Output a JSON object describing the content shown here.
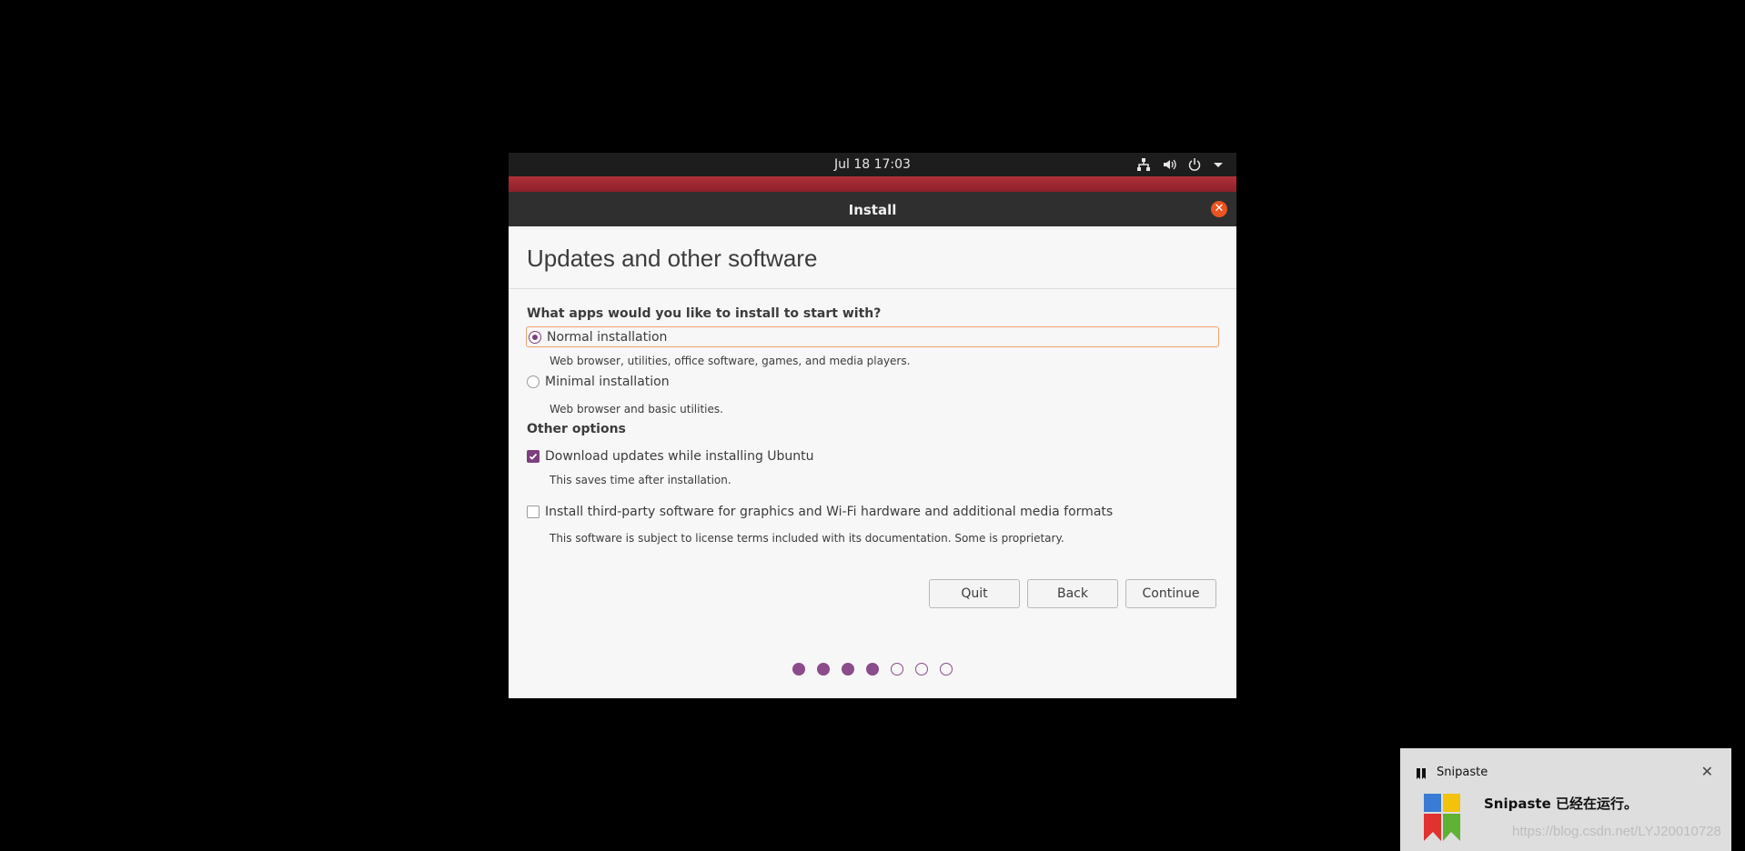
{
  "topbar": {
    "clock": "Jul 18  17:03",
    "icons": [
      "network-icon",
      "volume-icon",
      "power-icon",
      "dropdown-arrow-icon"
    ]
  },
  "window": {
    "title": "Install",
    "close_icon": "close-icon",
    "heading": "Updates and other software"
  },
  "apps": {
    "question": "What apps would you like to install to start with?",
    "normal": {
      "label": "Normal installation",
      "desc": "Web browser, utilities, office software, games, and media players.",
      "selected": true
    },
    "minimal": {
      "label": "Minimal installation",
      "desc": "Web browser and basic utilities.",
      "selected": false
    }
  },
  "other": {
    "title": "Other options",
    "updates": {
      "label": "Download updates while installing Ubuntu",
      "desc": "This saves time after installation.",
      "checked": true
    },
    "thirdparty": {
      "label": "Install third-party software for graphics and Wi-Fi hardware and additional media formats",
      "desc": "This software is subject to license terms included with its documentation. Some is proprietary.",
      "checked": false
    }
  },
  "buttons": {
    "quit": "Quit",
    "back": "Back",
    "continue": "Continue"
  },
  "progress": {
    "steps_total": 7,
    "steps_done": 4
  },
  "colors": {
    "accent": "#7e3f7e",
    "close": "#e95420",
    "focus": "#f0a070",
    "band": "#a4262f"
  },
  "toast": {
    "app_name": "Snipaste",
    "message": "Snipaste 已经在运行。"
  },
  "watermark": "https://blog.csdn.net/LYJ20010728"
}
